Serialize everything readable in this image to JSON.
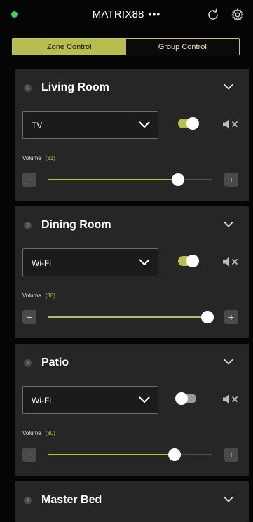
{
  "header": {
    "title": "MATRIX88",
    "more_glyph": "•••",
    "status_color": "#3fd35f"
  },
  "tabs": [
    {
      "label": "Zone Control",
      "active": true
    },
    {
      "label": "Group Control",
      "active": false
    }
  ],
  "colors": {
    "accent": "#b8bd52",
    "card": "#262626",
    "background": "#050505"
  },
  "zones": [
    {
      "index": "1",
      "name": "Living Room",
      "source": "TV",
      "power_on": true,
      "volume_label": "Volume",
      "volume": "(31)",
      "volume_level": 0.79,
      "minus": "−",
      "plus": "+"
    },
    {
      "index": "2",
      "name": "Dining Room",
      "source": "Wi-Fi",
      "power_on": true,
      "volume_label": "Volume",
      "volume": "(38)",
      "volume_level": 0.97,
      "minus": "−",
      "plus": "+"
    },
    {
      "index": "3",
      "name": "Patio",
      "source": "Wi-Fi",
      "power_on": false,
      "volume_label": "Volume",
      "volume": "(30)",
      "volume_level": 0.77,
      "minus": "−",
      "plus": "+"
    },
    {
      "index": "4",
      "name": "Master Bed"
    }
  ],
  "icons": {
    "refresh": "refresh-icon",
    "settings": "gear-icon",
    "expand": "chevron-down-icon",
    "mute": "speaker-muted-icon"
  }
}
